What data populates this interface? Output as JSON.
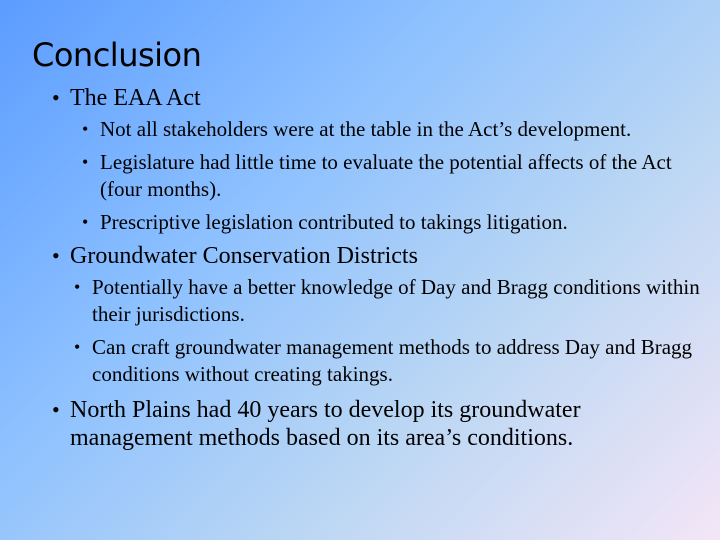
{
  "slide": {
    "title": "Conclusion",
    "items": [
      {
        "text": "The EAA Act",
        "subitems": [
          "Not all stakeholders were at the table in the Act’s development.",
          "Legislature had little time to evaluate the potential affects of the Act (four months).",
          "Prescriptive legislation contributed to takings litigation."
        ]
      },
      {
        "text": "Groundwater Conservation Districts",
        "subitems": [
          "Potentially have a better knowledge of Day and Bragg conditions within their jurisdictions.",
          "Can craft groundwater management methods to address Day and Bragg conditions without creating takings."
        ]
      },
      {
        "text": "North Plains had 40 years to develop its groundwater management methods based on its area’s conditions."
      }
    ],
    "bullet": "•"
  }
}
